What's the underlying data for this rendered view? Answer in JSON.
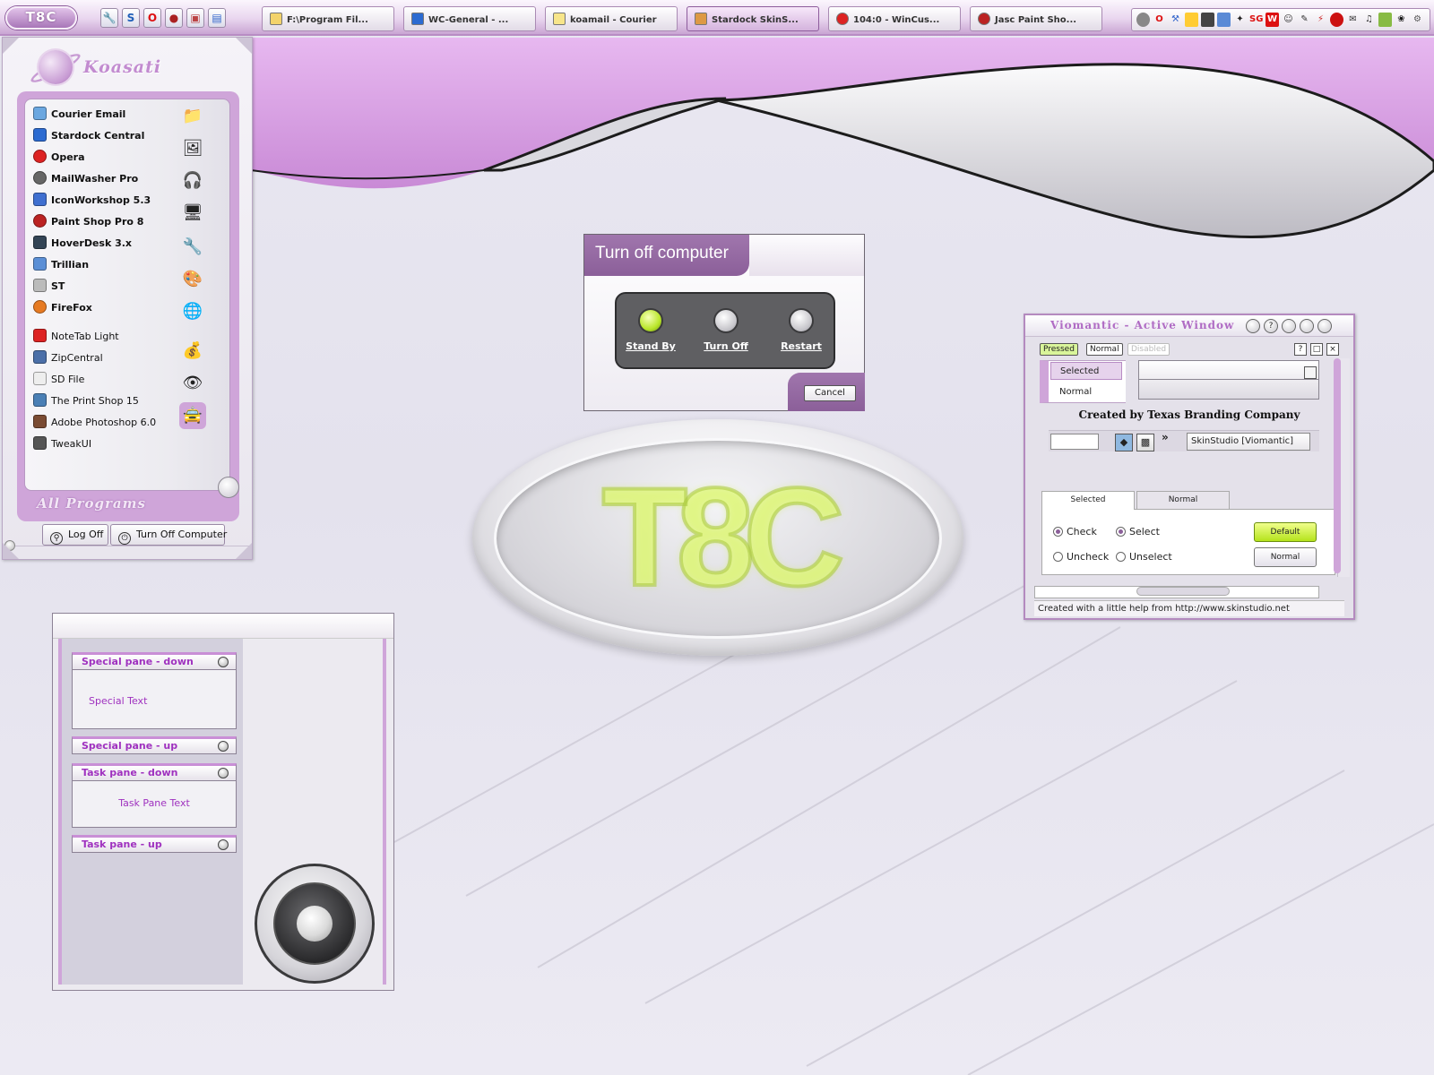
{
  "colors": {
    "accent": "#c79ad3",
    "accent_dark": "#8b5f99",
    "pane_text": "#9f31bf",
    "default_button": "#c2ec2a"
  },
  "taskbar": {
    "start_label": "T8C",
    "quicklaunch": [
      "wrench-icon",
      "stardock-icon",
      "opera-icon",
      "paintshop-icon",
      "picture-icon",
      "desktop-icon"
    ],
    "tasks": [
      {
        "label": "F:\\Program Fil...",
        "icon": "folder-icon"
      },
      {
        "label": "WC-General - ...",
        "icon": "stardock-icon"
      },
      {
        "label": "koamail - Courier",
        "icon": "mail-icon"
      },
      {
        "label": "Stardock SkinS...",
        "icon": "skinstudio-icon"
      },
      {
        "label": "104:0 - WinCus...",
        "icon": "opera-icon"
      },
      {
        "label": "Jasc Paint Sho...",
        "icon": "paintshop-icon"
      }
    ],
    "tray_text_icons": [
      "SG",
      "W"
    ]
  },
  "start_menu": {
    "brand": "Koasati",
    "pinned": [
      "Courier Email",
      "Stardock Central",
      "Opera",
      "MailWasher Pro",
      "IconWorkshop 5.3",
      "Paint Shop Pro 8",
      "HoverDesk 3.x",
      "Trillian",
      "ST",
      "FireFox"
    ],
    "recent": [
      "NoteTab Light",
      "ZipCentral",
      "SD File",
      "The Print Shop 15",
      "Adobe Photoshop 6.0",
      "TweakUI"
    ],
    "all_programs": "All Programs",
    "log_off": "Log Off",
    "turn_off": "Turn Off Computer"
  },
  "turnoff_dialog": {
    "title": "Turn off computer",
    "options": [
      "Stand By",
      "Turn Off",
      "Restart"
    ],
    "cancel": "Cancel"
  },
  "center_logo": {
    "text": "T8C"
  },
  "viomantic": {
    "title": "Viomantic - Active Window",
    "states": [
      "Pressed",
      "Normal",
      "Disabled"
    ],
    "list_items": [
      "Selected",
      "Normal"
    ],
    "created_by": "Created by Texas Branding Company",
    "skin_button": "SkinStudio [Viomantic]",
    "tabs": [
      "Selected",
      "Normal"
    ],
    "radios": [
      "Check",
      "Uncheck",
      "Select",
      "Unselect"
    ],
    "btn_default": "Default",
    "btn_normal": "Normal",
    "status": "Created with a little help from http://www.skinstudio.net"
  },
  "panes": {
    "special_down": "Special pane - down",
    "special_text": "Special Text",
    "special_up": "Special pane - up",
    "task_down": "Task pane - down",
    "task_text": "Task Pane Text",
    "task_up": "Task pane - up"
  }
}
